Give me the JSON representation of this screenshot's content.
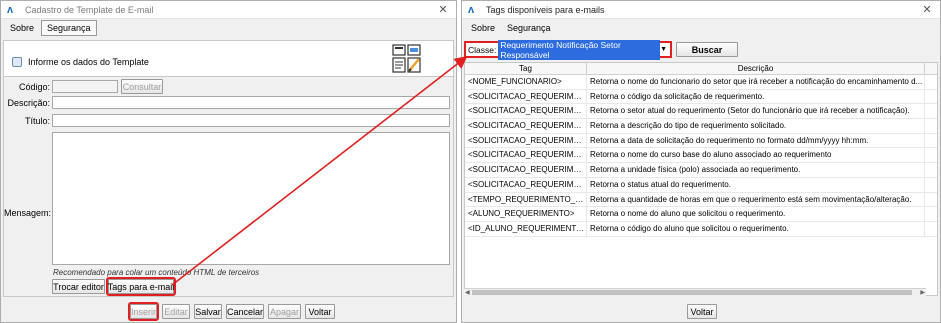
{
  "left_window": {
    "title": "Cadastro de Template de E-mail",
    "menu": [
      "Sobre",
      "Segurança"
    ],
    "panel_title": "Informe os dados do Template",
    "labels": {
      "codigo": "Código:",
      "descricao": "Descrição:",
      "titulo": "Título:",
      "mensagem": "Mensagem:"
    },
    "consultar_label": "Consultar",
    "hint": "Recomendado para colar um conteúdo HTML de terceiros",
    "trocar_editor_label": "Trocar editor",
    "tags_email_label": "Tags para e-mail",
    "footer_buttons": [
      "Inserir",
      "Editar",
      "Salvar",
      "Cancelar",
      "Apagar",
      "Voltar"
    ]
  },
  "right_window": {
    "title": "Tags disponíveis para e-mails",
    "menu": [
      "Sobre",
      "Segurança"
    ],
    "classe_label": "Classe:",
    "classe_value": "Requerimento Notificação Setor Responsável",
    "buscar_label": "Buscar",
    "columns": [
      "Tag",
      "Descrição"
    ],
    "rows": [
      {
        "tag": "<NOME_FUNCIONARIO>",
        "desc": "Retorna o nome do funcionario do setor que irá receber a notificação do encaminhamento d..."
      },
      {
        "tag": "<SOLICITACAO_REQUERIMENT...",
        "desc": "Retorna o código da solicitação de requerimento."
      },
      {
        "tag": "<SOLICITACAO_REQUERIMENT...",
        "desc": "Retorna o setor atual do requerimento (Setor do funcionário que irá receber a notificação)."
      },
      {
        "tag": "<SOLICITACAO_REQUERIMENT...",
        "desc": "Retorna a descrição do tipo de requerimento solicitado."
      },
      {
        "tag": "<SOLICITACAO_REQUERIMENT...",
        "desc": "Retorna a data de solicitação do requerimento no formato dd/mm/yyyy hh:mm."
      },
      {
        "tag": "<SOLICITACAO_REQUERIMENT...",
        "desc": "Retorna o nome do curso base do aluno associado ao requerimento"
      },
      {
        "tag": "<SOLICITACAO_REQUERIMENT...",
        "desc": "Retorna a unidade física (polo) associada ao requerimento."
      },
      {
        "tag": "<SOLICITACAO_REQUERIMENT...",
        "desc": "Retorna o status atual do requerimento."
      },
      {
        "tag": "<TEMPO_REQUERIMENTO_SEM...",
        "desc": "Retorna a quantidade de horas em que o requerimento está sem movimentação/alteração."
      },
      {
        "tag": "<ALUNO_REQUERIMENTO>",
        "desc": "Retorna o nome do aluno que solicitou o requerimento."
      },
      {
        "tag": "<ID_ALUNO_REQUERIMENTO>",
        "desc": "Retorna o código do aluno que solicitou o requerimento."
      }
    ],
    "voltar_label": "Voltar"
  },
  "colors": {
    "highlight": "#e02020",
    "selection": "#2d6cdf"
  }
}
